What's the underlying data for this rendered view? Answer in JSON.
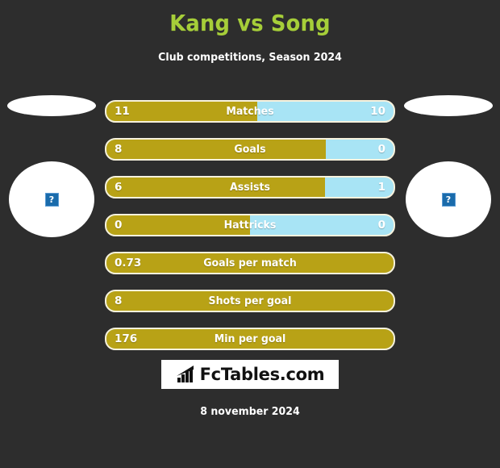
{
  "header": {
    "title": "Kang vs Song",
    "subtitle": "Club competitions, Season 2024",
    "title_color": "#a6ce39"
  },
  "players": {
    "home": {
      "photo_placeholder": "broken-image",
      "placeholder_glyph": "?"
    },
    "away": {
      "photo_placeholder": "broken-image",
      "placeholder_glyph": "?"
    }
  },
  "colors": {
    "background": "#2d2d2d",
    "home_bar": "#b8a216",
    "away_bar": "#a8e4f5",
    "bar_outline": "#f7f2dd",
    "accent": "#a6ce39"
  },
  "chart_data": {
    "type": "bar",
    "title": "Kang vs Song",
    "subtitle": "Club competitions, Season 2024",
    "orientation": "horizontal-diverging",
    "categories": [
      "Matches",
      "Goals",
      "Assists",
      "Hattricks",
      "Goals per match",
      "Shots per goal",
      "Min per goal"
    ],
    "series": [
      {
        "name": "Kang",
        "values": [
          "11",
          "8",
          "6",
          "0",
          "0.73",
          "8",
          "176"
        ]
      },
      {
        "name": "Song",
        "values": [
          "10",
          "0",
          "1",
          "0",
          null,
          null,
          null
        ]
      }
    ],
    "legend_position": "none",
    "grid": false
  },
  "rows": [
    {
      "label": "Matches",
      "home": "11",
      "away": "10",
      "home_pct": 52.4,
      "split": true
    },
    {
      "label": "Goals",
      "home": "8",
      "away": "0",
      "home_pct": 76.5,
      "split": true
    },
    {
      "label": "Assists",
      "home": "6",
      "away": "1",
      "home_pct": 76.0,
      "split": true
    },
    {
      "label": "Hattricks",
      "home": "0",
      "away": "0",
      "home_pct": 50.0,
      "split": true
    },
    {
      "label": "Goals per match",
      "home": "0.73",
      "away": "",
      "home_pct": 100,
      "split": false
    },
    {
      "label": "Shots per goal",
      "home": "8",
      "away": "",
      "home_pct": 100,
      "split": false
    },
    {
      "label": "Min per goal",
      "home": "176",
      "away": "",
      "home_pct": 100,
      "split": false
    }
  ],
  "footer": {
    "logo_text": "FcTables.com",
    "logo_icon": "bar-chart-icon",
    "date": "8 november 2024"
  }
}
